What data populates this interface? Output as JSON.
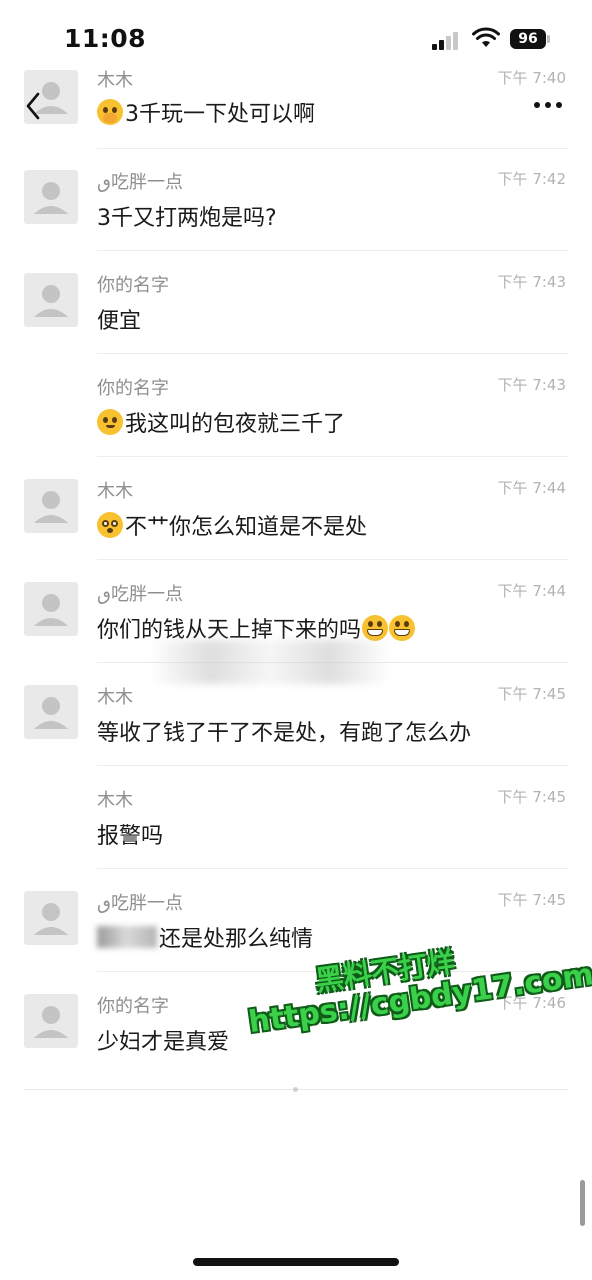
{
  "status_bar": {
    "time": "11:08",
    "battery": "96"
  },
  "messages": [
    {
      "name": "木木",
      "time": "下午 7:40",
      "emoji": "shush-emoji",
      "text": "3千玩一下处可以啊",
      "avatar": true
    },
    {
      "name": "ٯ吃胖一点",
      "time": "下午 7:42",
      "text": "3千又打两炮是吗?",
      "avatar": true
    },
    {
      "name": "你的名字",
      "time": "下午 7:43",
      "text": "便宜",
      "avatar": true
    },
    {
      "name": "你的名字",
      "time": "下午 7:43",
      "emoji": "smirk-emoji",
      "text": "我这叫的包夜就三千了",
      "avatar": false
    },
    {
      "name": "木木",
      "time": "下午 7:44",
      "emoji": "astonished-emoji",
      "text": "不艹你怎么知道是不是处",
      "avatar": true
    },
    {
      "name": "ٯ吃胖一点",
      "time": "下午 7:44",
      "text": "你们的钱从天上掉下来的吗",
      "emoji_after": "grin-emoji",
      "avatar": true
    },
    {
      "name": "木木",
      "time": "下午 7:45",
      "text": "等收了钱了干了不是处，有跑了怎么办",
      "avatar": true
    },
    {
      "name": "木木",
      "time": "下午 7:45",
      "text": "报警吗",
      "avatar": false
    },
    {
      "name": "ٯ吃胖一点",
      "time": "下午 7:45",
      "text": "还是处那么纯情",
      "blurred_prefix": true,
      "avatar": true
    },
    {
      "name": "你的名字",
      "time": "下午 7:46",
      "text": "少妇才是真爱",
      "avatar": true
    }
  ],
  "watermark": {
    "line1": "黑料不打烊",
    "line2": "https://cgbdy17.com"
  }
}
